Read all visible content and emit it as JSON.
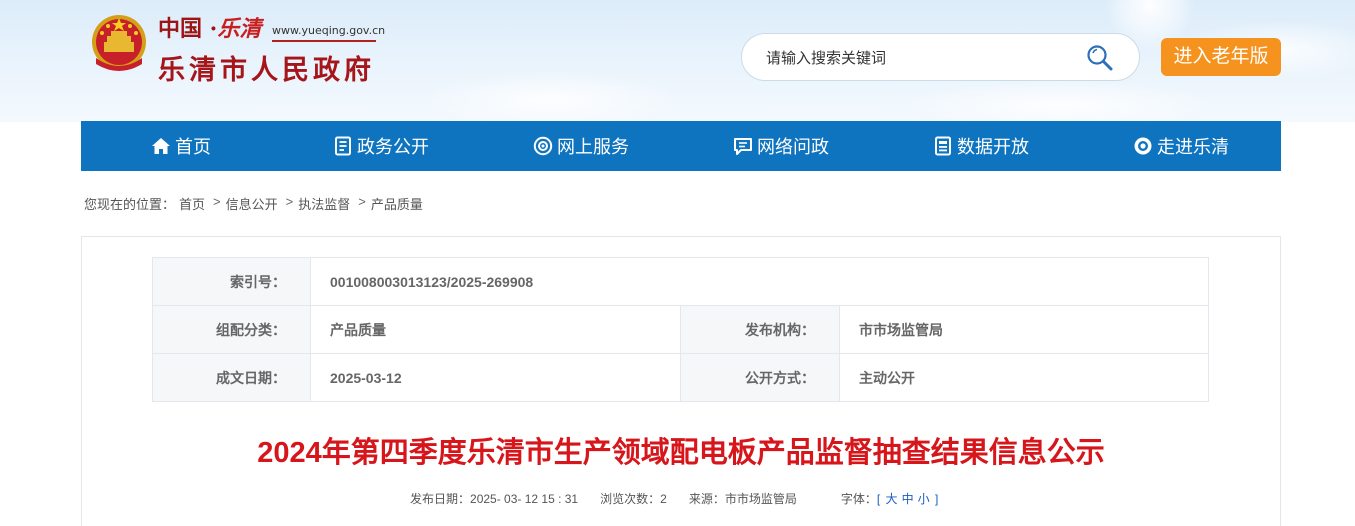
{
  "header": {
    "logo_top_prefix": "中国 · ",
    "logo_top_city": "乐清",
    "logo_url": "www.yueqing.gov.cn",
    "logo_main": "乐清市人民政府",
    "search_placeholder": "请输入搜索关键词",
    "elder_button": "进入老年版"
  },
  "nav": {
    "items": [
      {
        "label": "首页",
        "icon": "home-icon"
      },
      {
        "label": "政务公开",
        "icon": "document-icon"
      },
      {
        "label": "网上服务",
        "icon": "service-icon"
      },
      {
        "label": "网络问政",
        "icon": "chat-icon"
      },
      {
        "label": "数据开放",
        "icon": "data-icon"
      },
      {
        "label": "走进乐清",
        "icon": "eye-icon"
      }
    ]
  },
  "breadcrumb": {
    "prefix": "您现在的位置：",
    "items": [
      "首页",
      "信息公开",
      "执法监督",
      "产品质量"
    ],
    "separator": ">"
  },
  "meta": {
    "index_label": "索引号：",
    "index_value": "001008003013123/2025-269908",
    "category_label": "组配分类：",
    "category_value": "产品质量",
    "publisher_label": "发布机构：",
    "publisher_value": "市市场监管局",
    "date_label": "成文日期：",
    "date_value": "2025-03-12",
    "mode_label": "公开方式：",
    "mode_value": "主动公开"
  },
  "article": {
    "title": "2024年第四季度乐清市生产领域配电板产品监督抽查结果信息公示",
    "publish_label": "发布日期：",
    "publish_value": "2025- 03- 12 15 : 31",
    "views_label": "浏览次数：",
    "views_value": "2",
    "source_label": "来源：",
    "source_value": "市市场监管局",
    "font_label": "字体：",
    "font_bracket_open": "[",
    "font_large": "大",
    "font_medium": "中",
    "font_small": "小",
    "font_bracket_close": "]"
  },
  "colors": {
    "nav_bg": "#0f74c0",
    "title_red": "#d7161b",
    "elder_orange": "#f5931e"
  }
}
